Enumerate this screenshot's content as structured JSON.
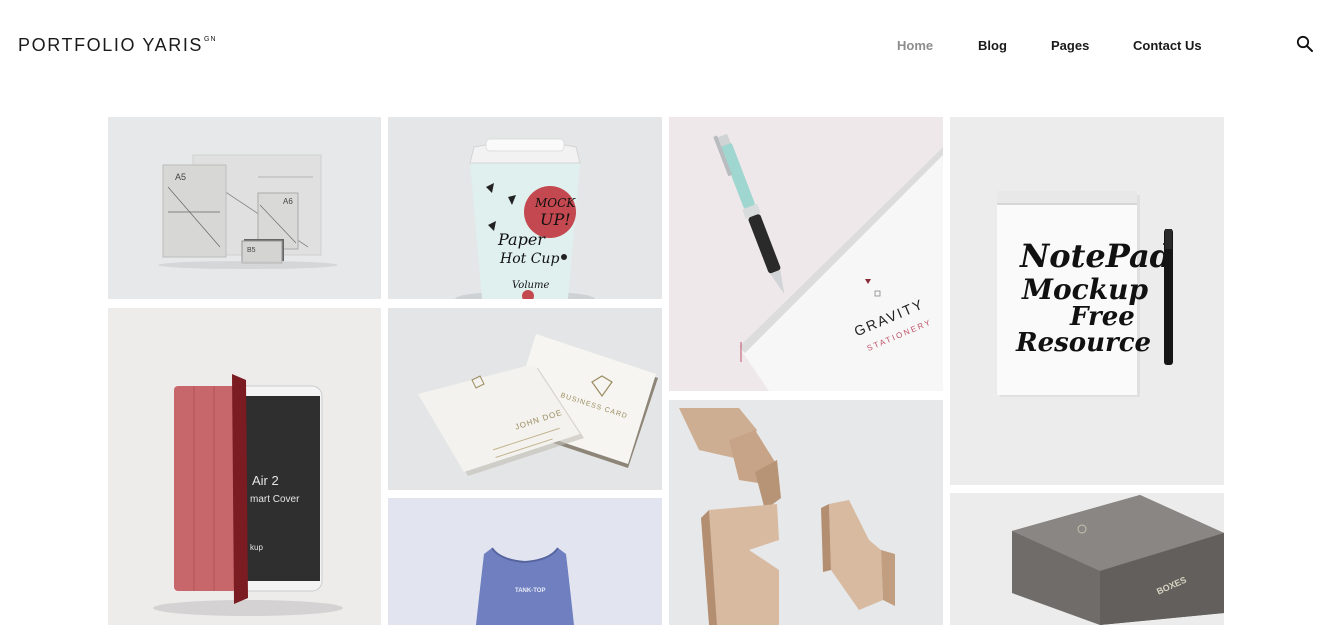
{
  "header": {
    "logo_text": "PORTFOLIO YARIS",
    "logo_superscript": "GN",
    "nav": [
      {
        "label": "Home",
        "active": true
      },
      {
        "label": "Blog",
        "active": false
      },
      {
        "label": "Pages",
        "active": false
      },
      {
        "label": "Contact Us",
        "active": false
      }
    ],
    "search_icon": "search-icon"
  },
  "portfolio": {
    "items": [
      {
        "name": "stationery-mockup",
        "labels": [
          "A5",
          "A6",
          "B5"
        ]
      },
      {
        "name": "paper-cup-mockup",
        "labels": [
          "MOCK",
          "UP!",
          "Paper",
          "Hot Cup",
          "Volume"
        ]
      },
      {
        "name": "pen-stationery-mockup",
        "labels": [
          "GRAVITY",
          "STATIONERY"
        ]
      },
      {
        "name": "notepad-mockup",
        "labels": [
          "NotePad",
          "Mockup",
          "Free",
          "Resource"
        ]
      },
      {
        "name": "ipad-cover-mockup",
        "labels": [
          "Air 2",
          "mart Cover",
          "kup"
        ]
      },
      {
        "name": "business-card-mockup",
        "labels": [
          "BUSINESS CARD",
          "JOHN DOE"
        ]
      },
      {
        "name": "wooden-blocks-mockup",
        "labels": []
      },
      {
        "name": "box-mockup",
        "labels": [
          "BOXES"
        ]
      },
      {
        "name": "tank-top-mockup",
        "labels": [
          "TANK-TOP"
        ]
      }
    ]
  },
  "colors": {
    "nav_active": "#8d8d8d",
    "text": "#1a1a1a",
    "cup_accent": "#c4484f",
    "pen_teal": "#9fd6cf"
  }
}
